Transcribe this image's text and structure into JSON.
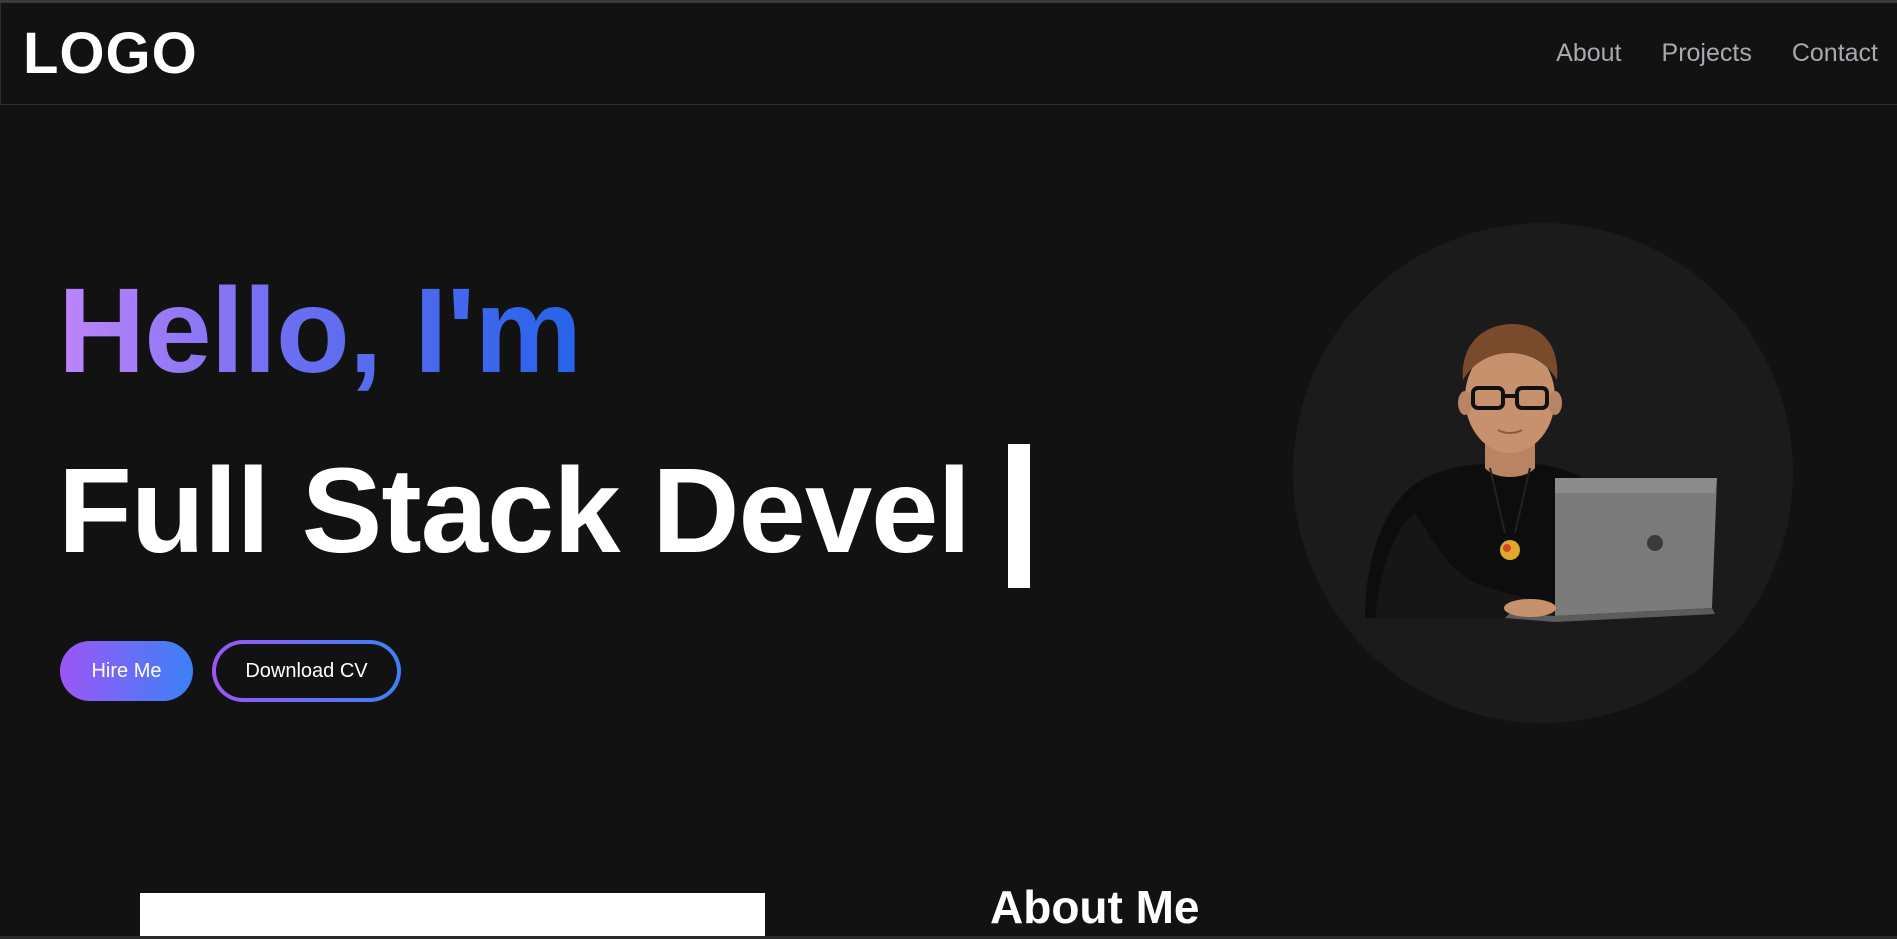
{
  "header": {
    "logo": "LOGO",
    "nav": [
      {
        "label": "About"
      },
      {
        "label": "Projects"
      },
      {
        "label": "Contact"
      }
    ]
  },
  "hero": {
    "greeting": "Hello, I'm",
    "typed_role": "Full Stack Devel",
    "buttons": {
      "hire": "Hire Me",
      "download_cv": "Download CV"
    }
  },
  "about": {
    "title": "About Me"
  },
  "colors": {
    "background": "#121212",
    "gradient_start": "#c084fc",
    "gradient_end": "#2563eb",
    "nav_text": "#a9a9b0",
    "avatar_circle": "#1b1b1b"
  },
  "icons": {
    "avatar": "developer-with-laptop-illustration"
  }
}
